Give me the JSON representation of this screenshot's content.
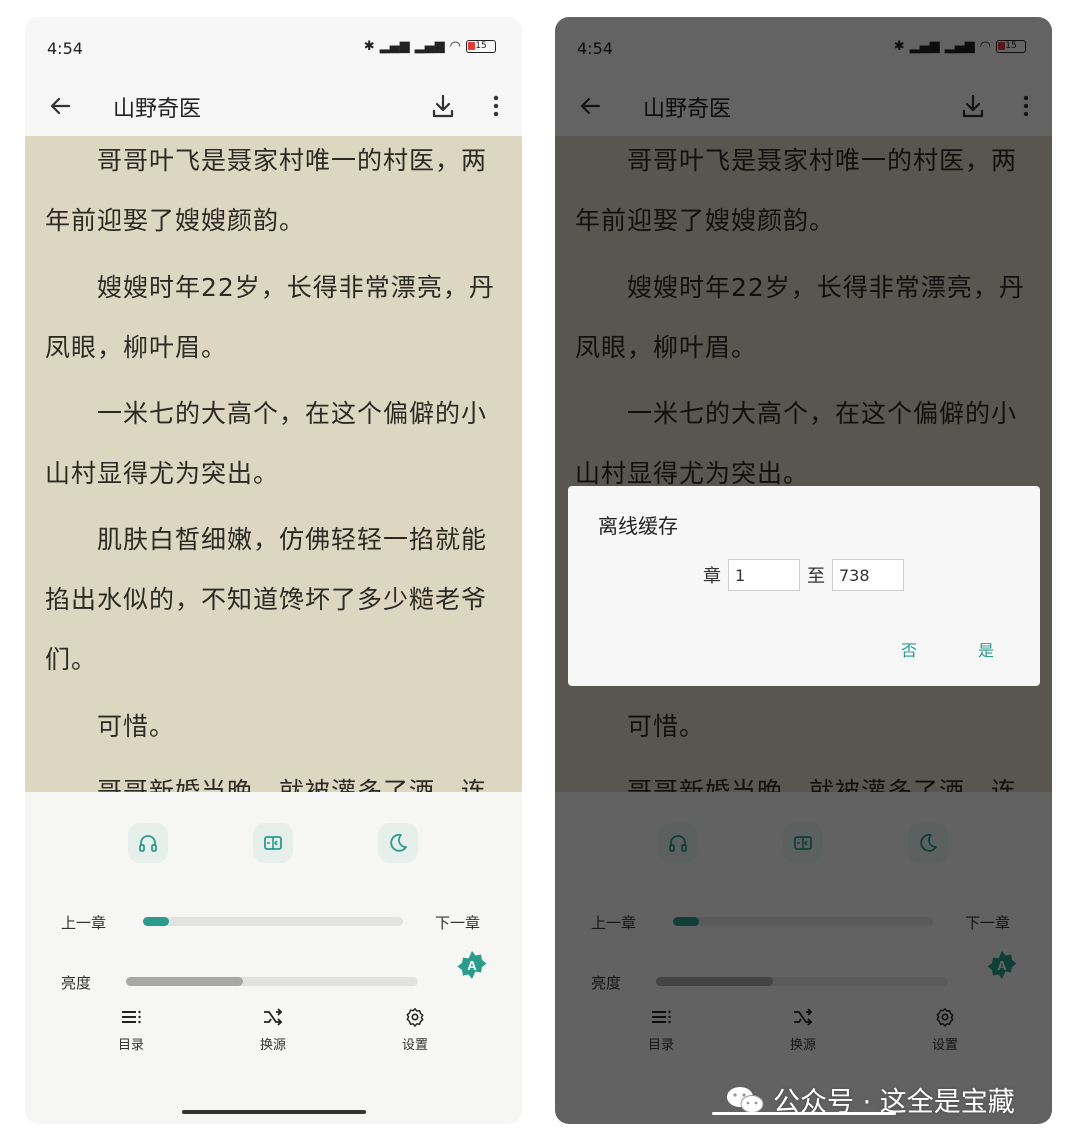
{
  "status": {
    "time": "4:54",
    "battery": "15"
  },
  "book": {
    "title": "山野奇医"
  },
  "content": {
    "paragraphs": [
      {
        "lines": [
          "哥哥叶飞是聂家村唯一的村医，两",
          "年前迎娶了嫂嫂颜韵。"
        ]
      },
      {
        "lines": [
          "嫂嫂时年22岁，长得非常漂亮，丹",
          "凤眼，柳叶眉。"
        ]
      },
      {
        "lines": [
          "一米七的大高个，在这个偏僻的小",
          "山村显得尤为突出。"
        ]
      },
      {
        "lines": [
          "肌肤白皙细嫩，仿佛轻轻一掐就能",
          "掐出水似的，不知道馋坏了多少糙老爷",
          "们。"
        ]
      },
      {
        "lines": [
          "可惜。"
        ]
      },
      {
        "lines": [
          "哥哥新婚当晚，就被灌多了酒，连"
        ]
      }
    ]
  },
  "panel": {
    "prev_chapter": "上一章",
    "next_chapter": "下一章",
    "chapter_progress": 0.1,
    "brightness_label": "亮度",
    "brightness_level": 0.4,
    "auto_brightness_icon": "A",
    "nav": {
      "catalog": "目录",
      "switch_source": "换源",
      "settings": "设置"
    }
  },
  "dialog": {
    "title": "离线缓存",
    "from_label": "章",
    "from_value": "1",
    "to_label": "至",
    "to_value": "738",
    "cancel": "否",
    "confirm": "是"
  },
  "watermark": {
    "text": "公众号 · 这全是宝藏"
  },
  "icons": {
    "back": "arrow-left-icon",
    "download": "download-icon",
    "more": "more-vert-icon",
    "listen": "headphones-icon",
    "page_turn": "page-turn-icon",
    "night": "moon-icon",
    "catalog": "list-icon",
    "source": "shuffle-icon",
    "settings": "gear-icon"
  },
  "colors": {
    "accent": "#2a9c8c",
    "reader_bg": "#ddd7c2",
    "text": "#2d2a24"
  }
}
